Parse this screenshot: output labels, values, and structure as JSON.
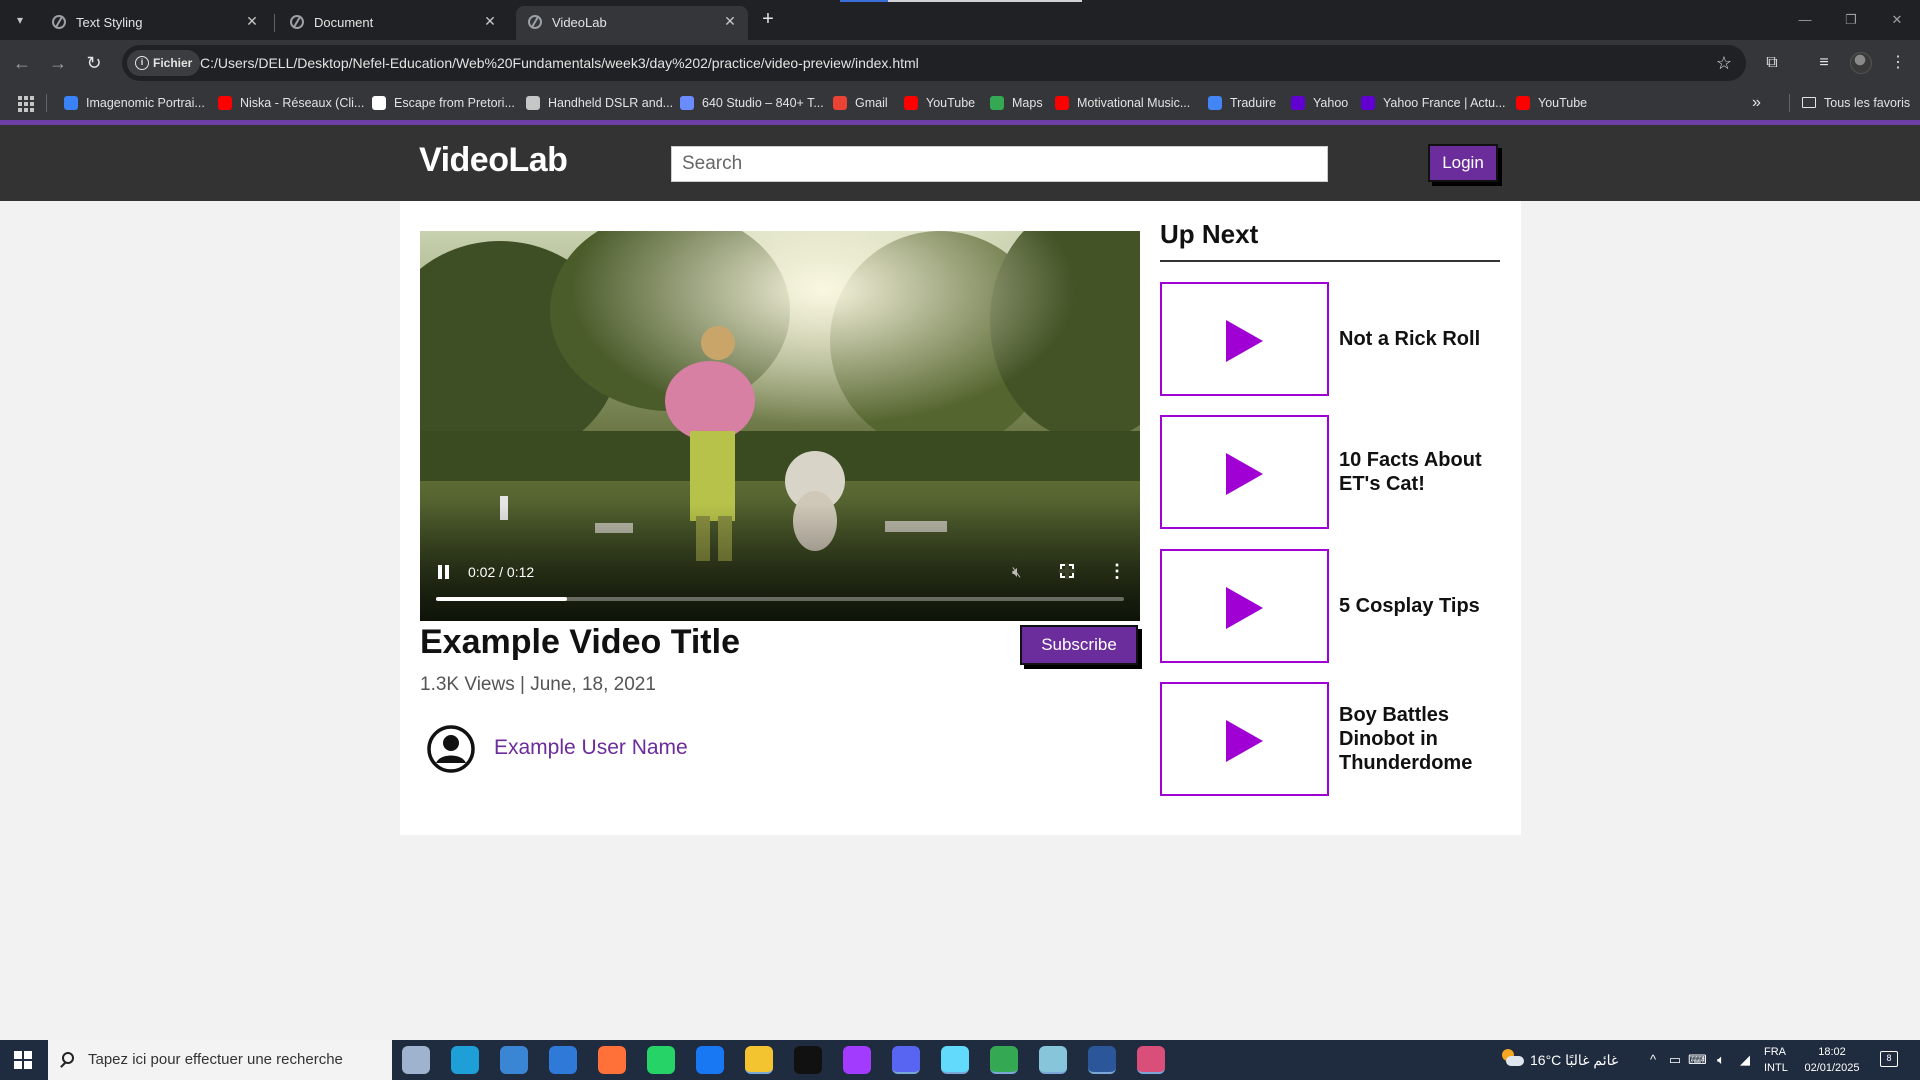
{
  "browser": {
    "tabs": [
      {
        "title": "Text Styling",
        "active": false
      },
      {
        "title": "Document",
        "active": false
      },
      {
        "title": "VideoLab",
        "active": true
      }
    ],
    "new_tab_symbol": "+",
    "chip_label": "Fichier",
    "url": "C:/Users/DELL/Desktop/Nefel-Education/Web%20Fundamentals/week3/day%202/practice/video-preview/index.html",
    "bookmarks": [
      {
        "label": "Imagenomic Portrai...",
        "icon": "bookmark-page-icon",
        "color": "#3b82f6"
      },
      {
        "label": "Niska - Réseaux (Cli...",
        "icon": "youtube-icon",
        "color": "#ff0000"
      },
      {
        "label": "Escape from Pretori...",
        "icon": "bookmark-page-icon",
        "color": "#ffffff"
      },
      {
        "label": "Handheld DSLR and...",
        "icon": "globe-icon",
        "color": "#c4c7c5"
      },
      {
        "label": "640 Studio – 840+ T...",
        "icon": "studio-icon",
        "color": "#6b8cff"
      },
      {
        "label": "Gmail",
        "icon": "gmail-icon",
        "color": "#ea4335"
      },
      {
        "label": "YouTube",
        "icon": "youtube-icon",
        "color": "#ff0000"
      },
      {
        "label": "Maps",
        "icon": "maps-icon",
        "color": "#34a853"
      },
      {
        "label": "Motivational Music...",
        "icon": "youtube-icon",
        "color": "#ff0000"
      },
      {
        "label": "Traduire",
        "icon": "translate-icon",
        "color": "#4285f4"
      },
      {
        "label": "Yahoo",
        "icon": "yahoo-icon",
        "color": "#6001d2"
      },
      {
        "label": "Yahoo France | Actu...",
        "icon": "yahoo-icon",
        "color": "#6001d2"
      },
      {
        "label": "YouTube",
        "icon": "youtube-icon",
        "color": "#ff0000"
      }
    ],
    "bookmarks_more": "»",
    "all_bookmarks_label": "Tous les favoris"
  },
  "site": {
    "logo": "VideoLab",
    "search_placeholder": "Search",
    "login_label": "Login",
    "accent": "#6b2c9c",
    "thumb_accent": "#a100d4"
  },
  "video": {
    "time": "0:02 / 0:12",
    "progress": 0.19,
    "title": "Example Video Title",
    "meta": "1.3K Views | June, 18, 2021",
    "subscribe_label": "Subscribe",
    "user_name": "Example User Name"
  },
  "up_next": {
    "heading": "Up Next",
    "items": [
      {
        "title": "Not a Rick Roll"
      },
      {
        "title": "10 Facts About ET's Cat!"
      },
      {
        "title": "5 Cosplay Tips"
      },
      {
        "title": "Boy Battles Dinobot in Thunderdome"
      }
    ]
  },
  "taskbar": {
    "search_placeholder": "Tapez ici pour effectuer une recherche",
    "weather": "16°C  غائم غالبًا",
    "lang_line1": "FRA",
    "lang_line2": "INTL",
    "time": "18:02",
    "date": "02/01/2025",
    "notifications": "8",
    "apps": [
      {
        "name": "task-view-icon",
        "color": "#9fb3cf"
      },
      {
        "name": "edge-icon",
        "color": "#1e9fd8"
      },
      {
        "name": "store-icon",
        "color": "#3a86d4"
      },
      {
        "name": "mail-icon",
        "color": "#2f7ad8"
      },
      {
        "name": "firefox-icon",
        "color": "#ff7139"
      },
      {
        "name": "whatsapp-icon",
        "color": "#25d366"
      },
      {
        "name": "facebook-icon",
        "color": "#1877f2"
      },
      {
        "name": "file-explorer-icon",
        "color": "#f4c430"
      },
      {
        "name": "tiktok-icon",
        "color": "#111111"
      },
      {
        "name": "messenger-icon",
        "color": "#a33bff"
      },
      {
        "name": "discord-icon",
        "color": "#5865f2"
      },
      {
        "name": "react-devtools-icon",
        "color": "#61dafb"
      },
      {
        "name": "chrome-icon",
        "color": "#34a853"
      },
      {
        "name": "notepad-icon",
        "color": "#86c5da"
      },
      {
        "name": "word-icon",
        "color": "#2b579a"
      },
      {
        "name": "paint-icon",
        "color": "#d94f7a"
      }
    ]
  }
}
